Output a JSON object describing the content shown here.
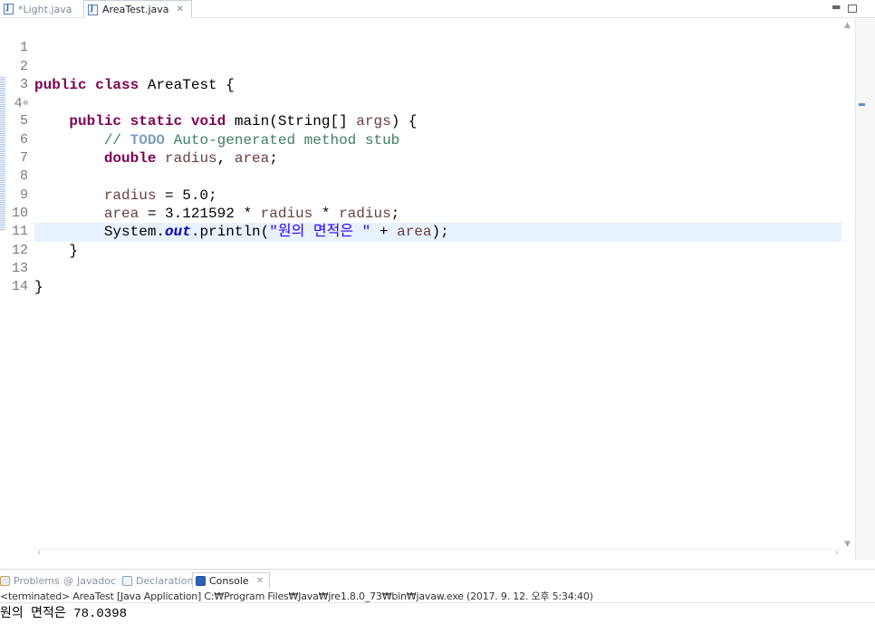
{
  "editor_tabs": [
    {
      "label": "*Light.java",
      "active": false
    },
    {
      "label": "AreaTest.java",
      "active": true
    }
  ],
  "code_lines": [
    {
      "num": "1"
    },
    {
      "num": "2"
    },
    {
      "num": "3"
    },
    {
      "num": "4"
    },
    {
      "num": "5"
    },
    {
      "num": "6"
    },
    {
      "num": "7"
    },
    {
      "num": "8"
    },
    {
      "num": "9"
    },
    {
      "num": "10"
    },
    {
      "num": "11"
    },
    {
      "num": "12"
    },
    {
      "num": "13"
    },
    {
      "num": "14"
    }
  ],
  "code": {
    "l2_kw1": "public",
    "l2_kw2": "class",
    "l2_rest": " AreaTest {",
    "l4_kw1": "public",
    "l4_kw2": "static",
    "l4_kw3": "void",
    "l4_rest": " main(String[] ",
    "l4_var": "args",
    "l4_end": ") {",
    "l5_comment_pre": "// ",
    "l5_todo": "TODO",
    "l5_comment_post": " Auto-generated method stub",
    "l6_kw": "double",
    "l6_var1": "radius",
    "l6_sep": ", ",
    "l6_var2": "area",
    "l6_end": ";",
    "l8_var": "radius",
    "l8_rest": " = 5.0;",
    "l9_var1": "area",
    "l9_mid": " = 3.121592 * ",
    "l9_var2": "radius",
    "l9_op": " * ",
    "l9_var3": "radius",
    "l9_end": ";",
    "l10_pre": "System.",
    "l10_static": "out",
    "l10_mid": ".println(",
    "l10_str": "\"원의 면적은 \"",
    "l10_plus": " + ",
    "l10_var": "area",
    "l10_end": ");",
    "l11": "}",
    "l13": "}"
  },
  "view_tabs": {
    "problems": "Problems",
    "javadoc": "Javadoc",
    "declaration": "Declaration",
    "console": "Console"
  },
  "console": {
    "header": "<terminated> AreaTest [Java Application] C:₩Program Files₩Java₩jre1.8.0_73₩bin₩javaw.exe (2017. 9. 12. 오후 5:34:40)",
    "output": "원의 면적은 78.0398"
  },
  "colors": {
    "keyword": "#7f0055",
    "comment": "#3f7f5f",
    "string": "#2a00ff",
    "local_variable": "#6a3e3e",
    "static_field": "#0000c0",
    "current_line": "#e8f2fe"
  }
}
